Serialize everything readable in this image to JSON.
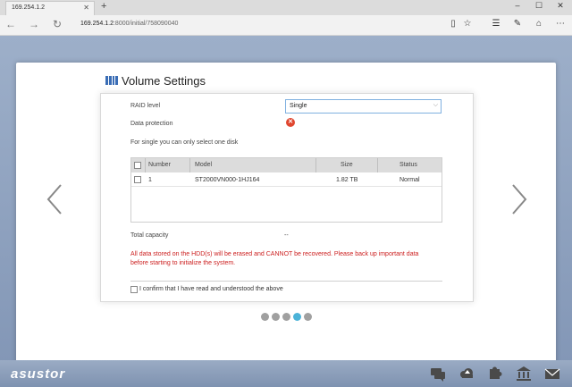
{
  "browser": {
    "tab_title": "169.254.1.2",
    "tab_close": "✕",
    "new_tab": "+",
    "url_host": "169.254.1.2",
    "url_path": ":8000/initial/758090040"
  },
  "wizard": {
    "title": "Volume Settings",
    "raid_label": "RAID level",
    "raid_value": "Single",
    "data_protection_label": "Data protection",
    "hint": "For single you can only select one disk",
    "table": {
      "headers": [
        "Number",
        "Model",
        "Size",
        "Status"
      ],
      "rows": [
        {
          "number": "1",
          "model": "ST2000VN000-1HJ164",
          "size": "1.82 TB",
          "status": "Normal"
        }
      ]
    },
    "total_capacity_label": "Total capacity",
    "total_capacity_value": "--",
    "warning": "All data stored on the HDD(s) will be erased and CANNOT be recovered. Please back up important data before starting to initialize the system.",
    "confirm_label": "I confirm that I have read and understood the above",
    "steps_total": 5,
    "step_active": 4
  },
  "footer": {
    "logo": "asustor",
    "icons": [
      "chat-icon",
      "cloud-icon",
      "puzzle-icon",
      "bank-icon",
      "email-icon"
    ]
  },
  "colors": {
    "accent": "#3a6db5",
    "warning": "#cc1f1f",
    "step_active": "#4cb3d8",
    "error_icon": "#e0462f"
  }
}
